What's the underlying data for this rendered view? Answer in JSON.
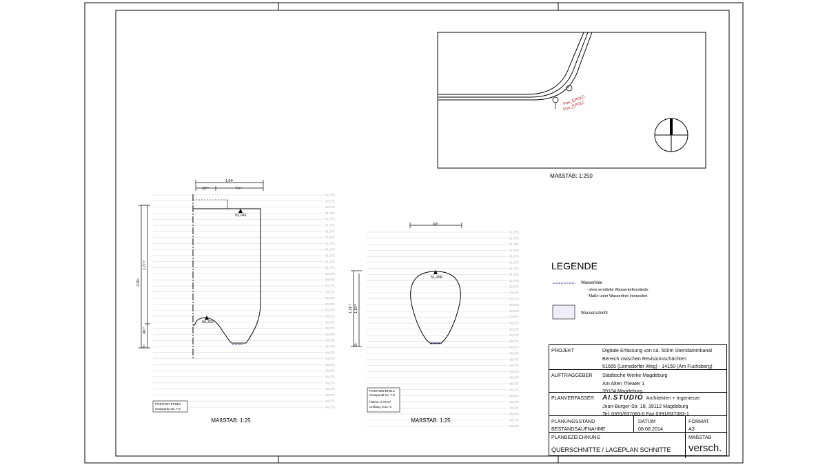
{
  "main_plan": {
    "scale_label": "MAßSTAB: 1:250",
    "markers": [
      "Pos_EP01D",
      "Pos_EP01C"
    ]
  },
  "section_left": {
    "scale_label": "MAßSTAB: 1:25",
    "top_dim": "1,04¹",
    "sub_dims": [
      "33⁰⁰",
      "71¹⁰"
    ],
    "vertical_dims": [
      "2,26⁸",
      "1,77⁴⁰",
      "48⁷⁰",
      "5⁵"
    ],
    "elevation_top": "52,041",
    "elevation_small": "50,329",
    "info_box": [
      "POSITION EP01D",
      "Scanpunkt zw. 7-8"
    ],
    "level_labels": [
      "52,375",
      "52,175",
      "52,075",
      "51,975",
      "51,875",
      "51,775",
      "51,675",
      "51,575",
      "51,475",
      "51,375",
      "51,275",
      "51,175",
      "51,075",
      "50,975",
      "50,875",
      "50,775",
      "50,675",
      "50,575",
      "50,475",
      "50,375",
      "50,275",
      "50,175",
      "50,075",
      "49,975",
      "49,875",
      "49,775",
      "49,675",
      "49,575",
      "49,475",
      "49,375",
      "49,275",
      "49,175",
      "49,075",
      "48,975",
      "48,875",
      "48,775"
    ]
  },
  "section_right": {
    "scale_label": "MAßSTAB: 1:25",
    "top_dim": "60⁰",
    "vertical_dims": [
      "1,21¹⁰",
      "1,19⁰⁰",
      "5⁵"
    ],
    "elevation_top": "51,268",
    "info_box": [
      "POSITION EP01C",
      "Scanpunkt zw. 7-8",
      "Fläche: 0,75 m²",
      "Umfang: 3,21 m"
    ],
    "level_labels": [
      "51,875",
      "51,775",
      "51,675",
      "51,575",
      "51,475",
      "51,375",
      "51,275",
      "51,175",
      "51,075",
      "50,975",
      "50,875",
      "50,775",
      "50,675",
      "50,575",
      "50,475",
      "50,375",
      "50,275",
      "50,175",
      "50,075",
      "49,975",
      "49,875",
      "49,775",
      "49,675",
      "49,575",
      "49,475",
      "49,375",
      "49,275",
      "49,175",
      "49,075",
      "48,975",
      "48,875",
      "48,775",
      "48,675"
    ]
  },
  "legend": {
    "title": "LEGENDE",
    "water_line_label": "Wasserlinie",
    "water_line_notes": [
      "- ohne ermittelte Wassertiefenstände",
      "- Maße unter Wasserlinie interpoliert"
    ],
    "water_layer_label": "Wasserschicht"
  },
  "title_block": {
    "projekt_label": "PROJEKT",
    "projekt_lines": [
      "Digitale Erfassung von ca. 500m Steindammkanal",
      "Bereich zwischen Revisionsschächten",
      "51655 (Lemsdorfer Weg) - 14150 (Am Fuchsberg)"
    ],
    "auftraggeber_label": "AUFTRAGGEBER",
    "auftraggeber_lines": [
      "Städtische Werke Magdeburg",
      "Am Alten Theater 1",
      "39104 Magdeburg"
    ],
    "planverfasser_label": "PLANVERFASSER",
    "planverfasser_logo": "AI.STUDIO",
    "planverfasser_lines": [
      "Architekten + Ingenieure",
      "Jean-Burger-Str. 18, 39112 Magdeburg",
      "Tel. 0391/837083-0   Fax 0391/837083-1"
    ],
    "planungsstand_label": "PLANUNGSSTAND",
    "planungsstand_value": "BESTANDSAUFNAHME",
    "datum_label": "DATUM",
    "datum_value": "08.08.2014",
    "format_label": "FORMAT",
    "format_value": "A3",
    "planbezeichnung_label": "PLANBEZEICHNUNG",
    "planbezeichnung_value": "QUERSCHNITTE / LAGEPLAN SCHNITTE",
    "massstab_label": "MAßSTAB",
    "massstab_value": "versch."
  },
  "colors": {
    "frame": "#000000",
    "level_lines": "#d0d0d0",
    "level_text": "#b0b0b0",
    "marker_red": "#cc2222",
    "water_line": "#4a4ab8",
    "water_fill": "#eeeefa"
  }
}
